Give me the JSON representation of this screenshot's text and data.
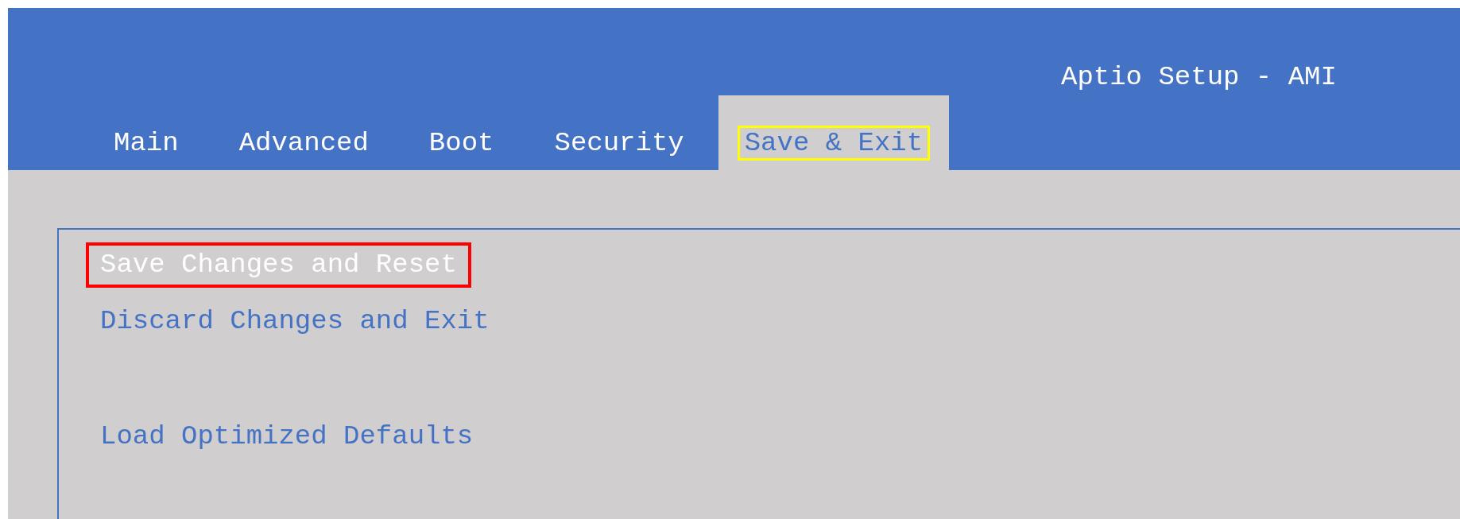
{
  "window": {
    "title": "Aptio Setup - AMI"
  },
  "tabs": [
    {
      "label": "Main",
      "selected": false,
      "outlined": false
    },
    {
      "label": "Advanced",
      "selected": false,
      "outlined": false
    },
    {
      "label": "Boot",
      "selected": false,
      "outlined": false
    },
    {
      "label": "Security",
      "selected": false,
      "outlined": false
    },
    {
      "label": "Save & Exit",
      "selected": true,
      "outlined": true
    }
  ],
  "menu": {
    "items": [
      {
        "label": "Save Changes and Reset",
        "selected": true,
        "outlined": true
      },
      {
        "label": "Discard Changes and Exit",
        "selected": false,
        "outlined": false
      },
      {
        "kind": "spacer"
      },
      {
        "label": "Load Optimized Defaults",
        "selected": false,
        "outlined": false
      }
    ]
  }
}
